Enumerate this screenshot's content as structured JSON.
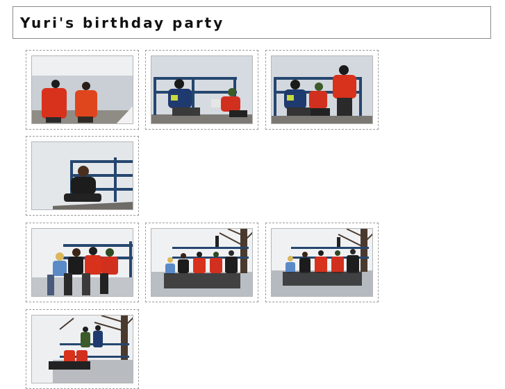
{
  "album": {
    "title": "Yuri's birthday party"
  },
  "gallery": {
    "photos": [
      {
        "subject": "two children in red jackets by the lake",
        "icon": "photo-thumbnail"
      },
      {
        "subject": "two children sitting on a bench by a railing",
        "icon": "photo-thumbnail"
      },
      {
        "subject": "three children on a bench, one standing",
        "icon": "photo-thumbnail"
      },
      {
        "subject": "girl sitting by a blue railing",
        "icon": "photo-thumbnail"
      },
      {
        "subject": "four children sitting on a wall",
        "icon": "photo-thumbnail"
      },
      {
        "subject": "group of children sitting on a wall with tree",
        "icon": "photo-thumbnail"
      },
      {
        "subject": "group of children sitting on a wall with tree",
        "icon": "photo-thumbnail"
      },
      {
        "subject": "children on a wall under a bare tree",
        "icon": "photo-thumbnail"
      }
    ]
  },
  "colors": {
    "red_jacket": "#d8311c",
    "railing_blue": "#25466e",
    "sky": "#e3e6ea",
    "ground": "#cfd3d8"
  }
}
